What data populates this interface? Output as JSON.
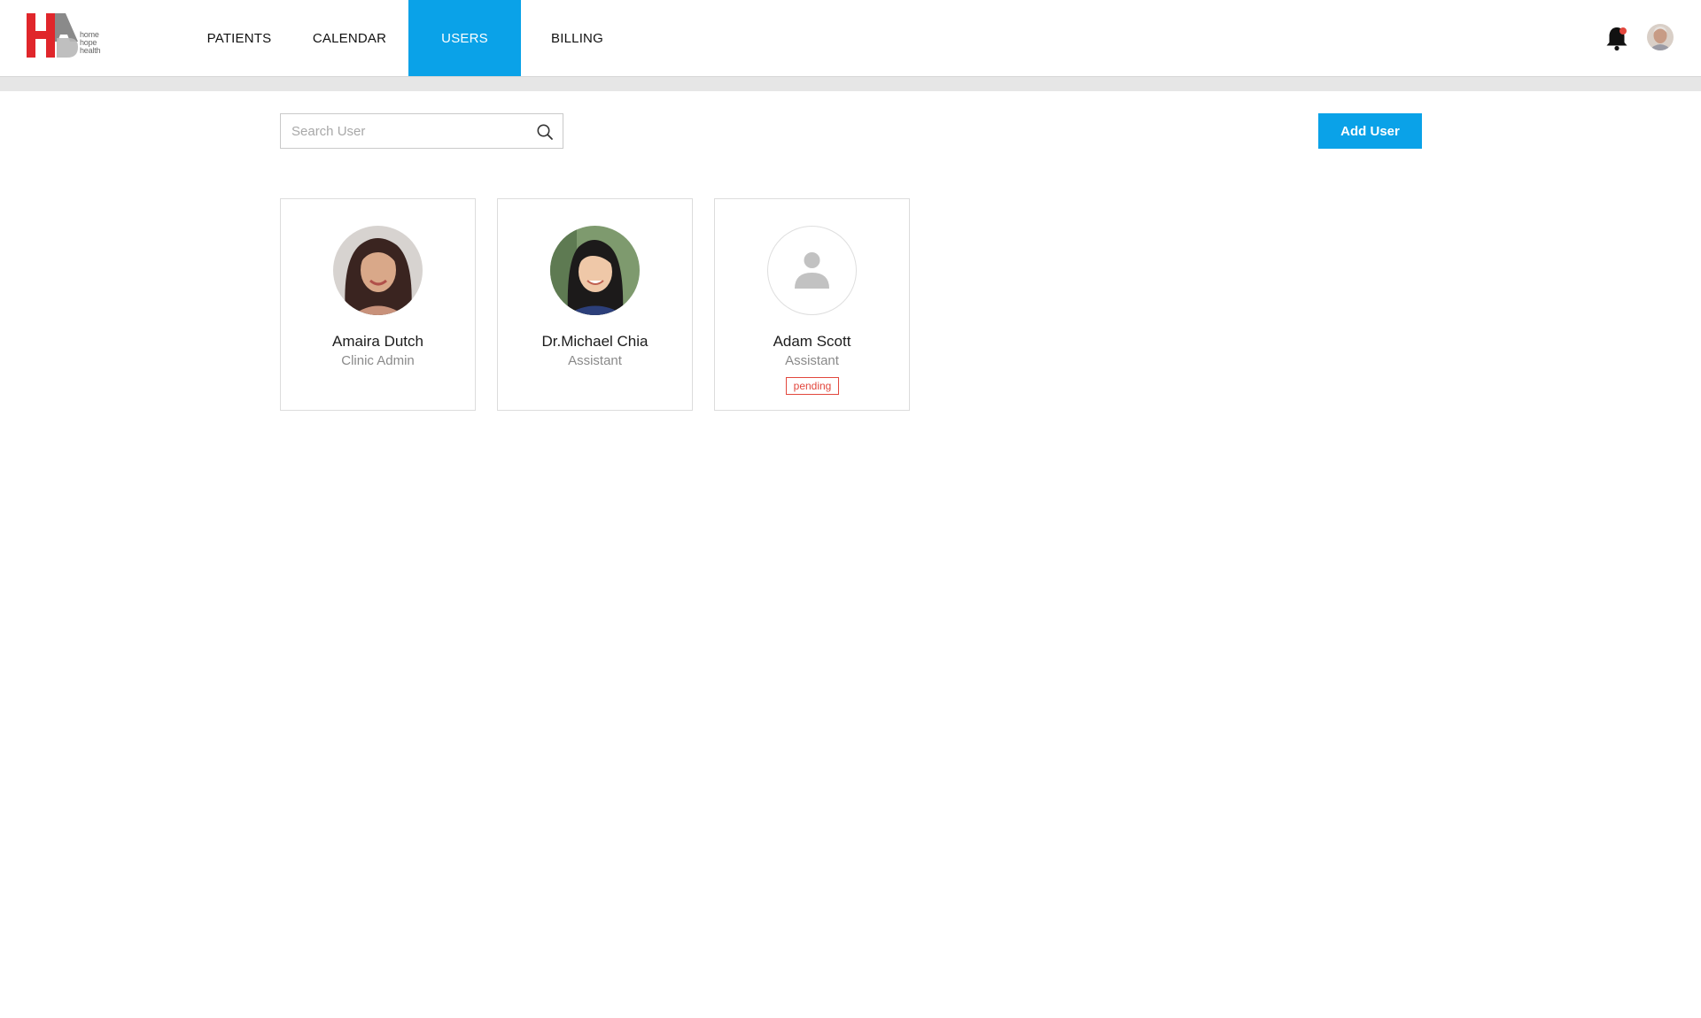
{
  "app": {
    "logo_letters": "HAB",
    "logo_words": [
      "home",
      "hope",
      "health"
    ]
  },
  "nav": {
    "items": [
      {
        "label": "PATIENTS",
        "active": false
      },
      {
        "label": "CALENDAR",
        "active": false
      },
      {
        "label": "USERS",
        "active": true
      },
      {
        "label": "BILLING",
        "active": false
      }
    ]
  },
  "header": {
    "notification_icon": "bell-icon",
    "profile_icon": "avatar"
  },
  "toolbar": {
    "search_placeholder": "Search User",
    "search_value": "",
    "add_label": "Add User"
  },
  "users": [
    {
      "name": "Amaira Dutch",
      "role": "Clinic Admin",
      "status": "",
      "avatar": "photo"
    },
    {
      "name": "Dr.Michael Chia",
      "role": "Assistant",
      "status": "",
      "avatar": "photo"
    },
    {
      "name": "Adam Scott",
      "role": "Assistant",
      "status": "pending",
      "avatar": "placeholder"
    }
  ],
  "colors": {
    "accent": "#0aa2e8",
    "brand_red": "#e0262b",
    "pending": "#e2473d"
  }
}
